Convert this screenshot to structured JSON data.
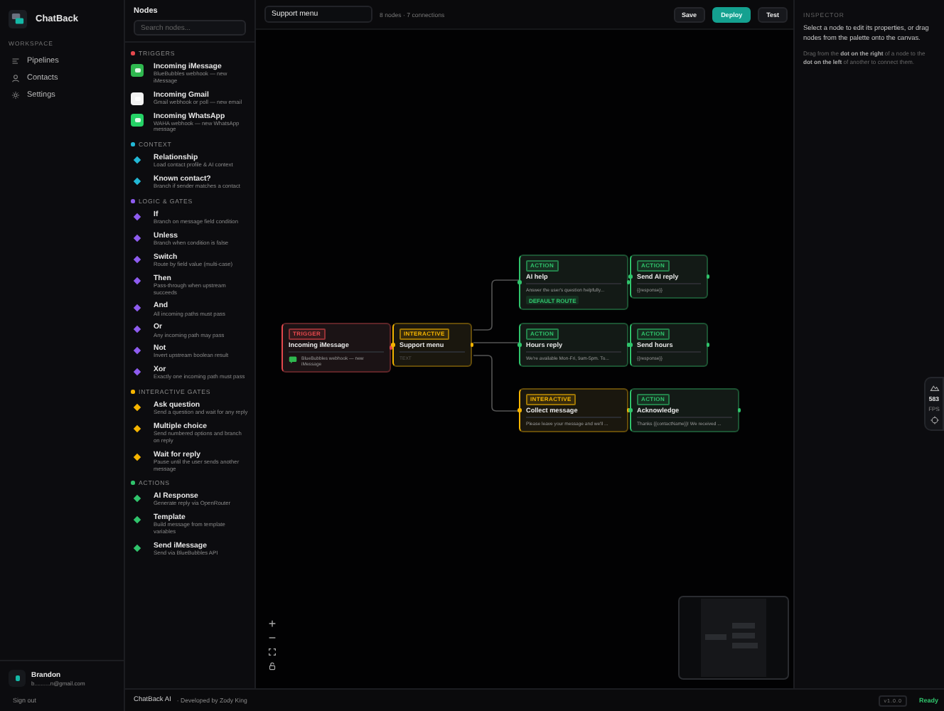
{
  "app": {
    "name": "ChatBack"
  },
  "nav": {
    "heading": "WORKSPACE",
    "items": [
      {
        "label": "Pipelines",
        "selected": false
      },
      {
        "label": "Contacts",
        "selected": false
      },
      {
        "label": "Settings",
        "selected": false
      }
    ]
  },
  "user": {
    "name": "Brandon",
    "email": "b..........n@gmail.com",
    "sign_out": "Sign out"
  },
  "palette": {
    "title": "Nodes",
    "search_placeholder": "Search nodes...",
    "sections": [
      {
        "title": "TRIGGERS",
        "color": "#e5484d",
        "items": [
          {
            "title": "Incoming iMessage",
            "desc": "BlueBubbles webhook — new iMessage",
            "color": "#2fb84f"
          },
          {
            "title": "Incoming Gmail",
            "desc": "Gmail webhook or poll — new email",
            "color": "#f2f2f2"
          },
          {
            "title": "Incoming WhatsApp",
            "desc": "WAHA webhook — new WhatsApp message",
            "color": "#25d366"
          }
        ]
      },
      {
        "title": "CONTEXT",
        "color": "#22b8d6",
        "items": [
          {
            "title": "Relationship",
            "desc": "Load contact profile & AI context",
            "color": "#22b8d6"
          },
          {
            "title": "Known contact?",
            "desc": "Branch if sender matches a contact",
            "color": "#22b8d6"
          }
        ]
      },
      {
        "title": "LOGIC & GATES",
        "color": "#8e5cf0",
        "items": [
          {
            "title": "If",
            "desc": "Branch on message field condition",
            "color": "#8e5cf0"
          },
          {
            "title": "Unless",
            "desc": "Branch when condition is false",
            "color": "#8e5cf0"
          },
          {
            "title": "Switch",
            "desc": "Route by field value (multi-case)",
            "color": "#8e5cf0"
          },
          {
            "title": "Then",
            "desc": "Pass-through when upstream succeeds",
            "color": "#8e5cf0"
          },
          {
            "title": "And",
            "desc": "All incoming paths must pass",
            "color": "#8e5cf0"
          },
          {
            "title": "Or",
            "desc": "Any incoming path may pass",
            "color": "#8e5cf0"
          },
          {
            "title": "Not",
            "desc": "Invert upstream boolean result",
            "color": "#8e5cf0"
          },
          {
            "title": "Xor",
            "desc": "Exactly one incoming path must pass",
            "color": "#8e5cf0"
          }
        ]
      },
      {
        "title": "INTERACTIVE GATES",
        "color": "#f5b400",
        "items": [
          {
            "title": "Ask question",
            "desc": "Send a question and wait for any reply",
            "color": "#f5b400"
          },
          {
            "title": "Multiple choice",
            "desc": "Send numbered options and branch on reply",
            "color": "#f5b400"
          },
          {
            "title": "Wait for reply",
            "desc": "Pause until the user sends another message",
            "color": "#f5b400"
          }
        ]
      },
      {
        "title": "ACTIONS",
        "color": "#30c46c",
        "items": [
          {
            "title": "AI Response",
            "desc": "Generate reply via OpenRouter",
            "color": "#30c46c"
          },
          {
            "title": "Template",
            "desc": "Build message from template variables",
            "color": "#30c46c"
          },
          {
            "title": "Send iMessage",
            "desc": "Send via BlueBubbles API",
            "color": "#30c46c"
          }
        ]
      }
    ]
  },
  "toolbar": {
    "pipeline_name": "Support menu",
    "stats": "8 nodes · 7 connections",
    "buttons": [
      {
        "label": "Save",
        "kind": "default"
      },
      {
        "label": "Deploy",
        "kind": "primary"
      },
      {
        "label": "Test",
        "kind": "default"
      }
    ]
  },
  "canvas": {
    "nodes": [
      {
        "kind": "trigger",
        "badge": "TRIGGER",
        "title": "Incoming iMessage",
        "body": "BlueBubbles webhook — new iMessage"
      },
      {
        "kind": "interactive",
        "badge": "INTERACTIVE",
        "title": "Support menu",
        "body": "TEXT"
      },
      {
        "kind": "action",
        "badge": "ACTION",
        "title": "AI help",
        "body": "Answer the user's question helpfully...",
        "tag": "DEFAULT ROUTE"
      },
      {
        "kind": "action",
        "badge": "ACTION",
        "title": "Send AI reply",
        "body": "{{response}}"
      },
      {
        "kind": "action",
        "badge": "ACTION",
        "title": "Hours reply",
        "body": "We're available Mon-Fri, 9am-5pm. To..."
      },
      {
        "kind": "action",
        "badge": "ACTION",
        "title": "Send hours",
        "body": "{{response}}"
      },
      {
        "kind": "interactive",
        "badge": "INTERACTIVE",
        "title": "Collect message",
        "body": "Please leave your message and we'll ..."
      },
      {
        "kind": "action",
        "badge": "ACTION",
        "title": "Acknowledge",
        "body": "Thanks {{contactName}}! We received ..."
      }
    ]
  },
  "inspector": {
    "heading": "INSPECTOR",
    "text": "Select a node to edit its properties, or drag nodes from the palette onto the canvas.",
    "hint": "Drag from the **dot on the right** of a node to the **dot on the left** of another to connect them."
  },
  "perf": {
    "value": "583",
    "unit": "FPS"
  },
  "footer": {
    "brand": "ChatBack AI",
    "credit": "· Developed by Zody King",
    "version": "v1.0.0",
    "status": "Ready"
  }
}
